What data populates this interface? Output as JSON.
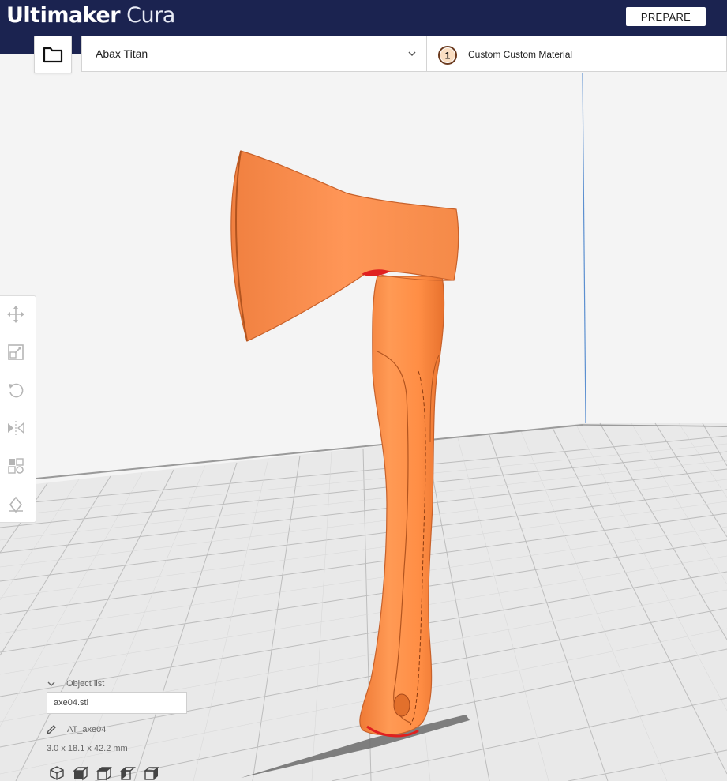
{
  "app": {
    "title_bold": "Ultimaker",
    "title_light": "Cura"
  },
  "header": {
    "stage_button": "PREPARE"
  },
  "printer": {
    "name": "Abax Titan",
    "extruder_number": "1",
    "material": "Custom Custom Material"
  },
  "toolbar": {
    "tools": [
      "move-icon",
      "scale-icon",
      "rotate-icon",
      "mirror-icon",
      "per-model-settings-icon",
      "support-blocker-icon"
    ]
  },
  "object_list": {
    "header": "Object list",
    "file_name": "axe04.stl",
    "object_name": "AT_axe04",
    "dimensions": "3.0 x 18.1 x 42.2 mm"
  },
  "camera_views": [
    "3d-view-icon",
    "front-view-icon",
    "top-view-icon",
    "left-view-icon",
    "right-view-icon"
  ],
  "colors": {
    "brand_bar": "#1b2350",
    "model": "#ff8c4a",
    "accent_red": "#e02020",
    "grid": "#c9c9c9"
  }
}
